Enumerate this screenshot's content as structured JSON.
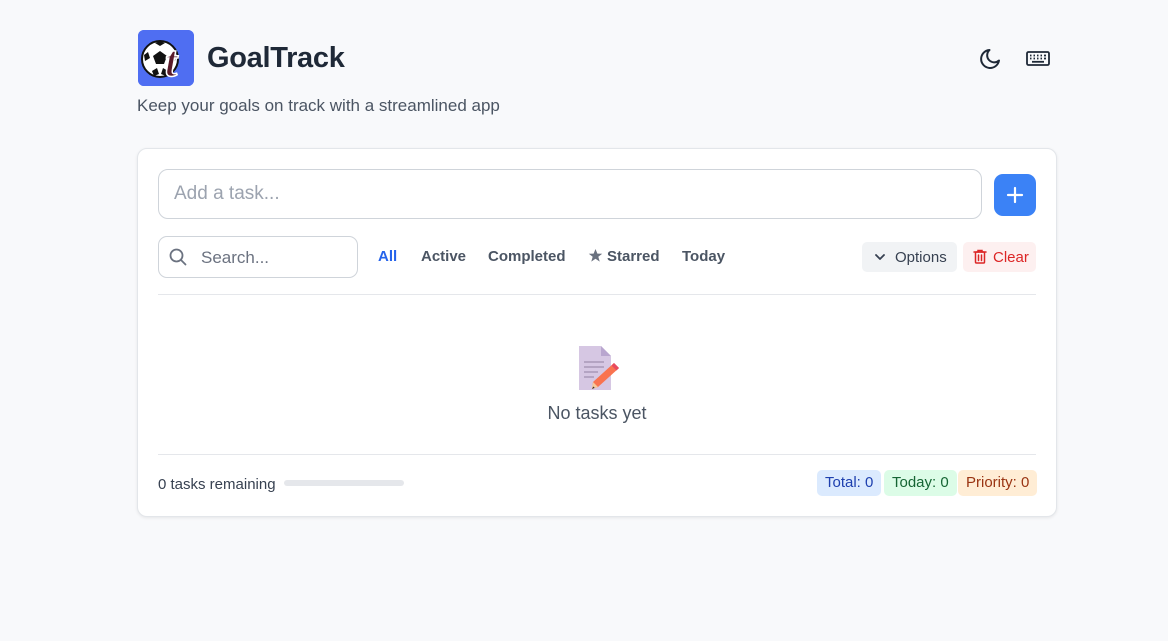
{
  "app": {
    "title": "GoalTrack",
    "subtitle": "Keep your goals on track with a streamlined app",
    "logo_icon": "soccer-ball-t-logo"
  },
  "header_actions": {
    "theme_icon": "moon-icon",
    "shortcuts_icon": "keyboard-icon"
  },
  "task_input": {
    "placeholder": "Add a task...",
    "value": ""
  },
  "add_button": {
    "icon": "plus-icon"
  },
  "search": {
    "placeholder": "Search...",
    "value": ""
  },
  "filters": [
    {
      "label": "All",
      "active": true
    },
    {
      "label": "Active",
      "active": false
    },
    {
      "label": "Completed",
      "active": false
    },
    {
      "label": "Starred",
      "active": false
    },
    {
      "label": "Today",
      "active": false
    }
  ],
  "options_button": {
    "label": "Options"
  },
  "clear_button": {
    "label": "Clear"
  },
  "empty_state": {
    "icon": "memo-icon",
    "text": "No tasks yet"
  },
  "footer": {
    "remaining": "0 tasks remaining",
    "progress": 0,
    "badges": {
      "total": "Total: 0",
      "today": "Today: 0",
      "priority": "Priority: 0"
    }
  },
  "colors": {
    "accent": "#3b82f6",
    "danger": "#dc2626",
    "background": "#f8f9fb"
  }
}
